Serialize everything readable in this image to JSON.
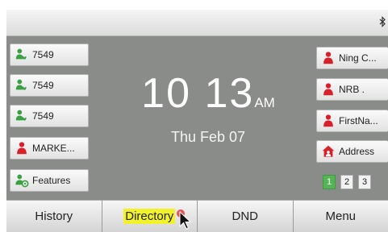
{
  "status_bar": {
    "bluetooth_icon": "bluetooth-icon"
  },
  "left_keys": [
    {
      "label": "7549",
      "icon": "green-handset-icon"
    },
    {
      "label": "7549",
      "icon": "green-handset-icon"
    },
    {
      "label": "7549",
      "icon": "green-handset-icon"
    },
    {
      "label": "MARKE...",
      "icon": "red-person-icon"
    },
    {
      "label": "Features",
      "icon": "features-icon"
    }
  ],
  "right_keys": [
    {
      "label": "Ning C...",
      "icon": "red-person-icon"
    },
    {
      "label": "NRB .",
      "icon": "red-person-icon"
    },
    {
      "label": "FirstNa...",
      "icon": "red-person-icon"
    },
    {
      "label": "Address",
      "icon": "address-book-icon"
    }
  ],
  "clock": {
    "time": "10 13",
    "ampm": "AM",
    "date": "Thu Feb 07"
  },
  "pages": [
    {
      "label": "1",
      "active": true
    },
    {
      "label": "2",
      "active": false
    },
    {
      "label": "3",
      "active": false
    }
  ],
  "softkeys": {
    "history": "History",
    "directory": "Directory",
    "dnd": "DND",
    "menu": "Menu"
  },
  "colors": {
    "screen_bg": "#8a8c89",
    "green_icon": "#3aa043",
    "red_icon": "#d8202a",
    "highlight": "#f1f22a",
    "page_active": "#56b456"
  }
}
